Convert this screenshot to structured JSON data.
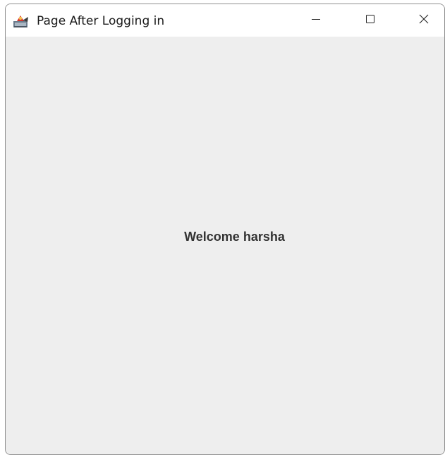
{
  "window": {
    "title": "Page After Logging in",
    "app_icon": "java-icon",
    "controls": {
      "minimize_icon": "minimize-icon",
      "maximize_icon": "maximize-icon",
      "close_icon": "close-icon"
    }
  },
  "content": {
    "welcome_text": "Welcome harsha"
  },
  "colors": {
    "content_background": "#eeeeee",
    "titlebar_background": "#ffffff",
    "welcome_text": "#333333"
  }
}
